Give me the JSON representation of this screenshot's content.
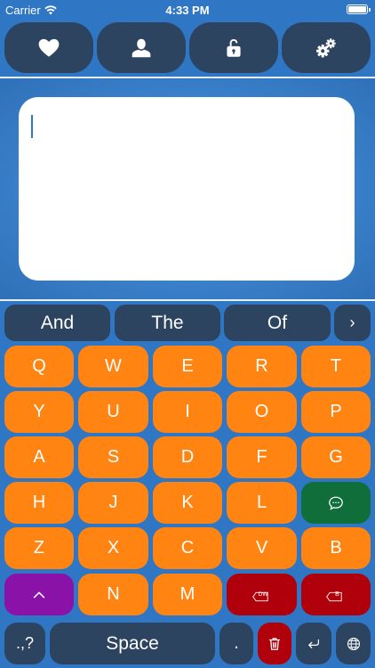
{
  "status": {
    "carrier": "Carrier",
    "time": "4:33 PM"
  },
  "toolbar": {
    "buttons": [
      {
        "name": "favorites",
        "icon": "heart-icon"
      },
      {
        "name": "profile",
        "icon": "user-icon"
      },
      {
        "name": "lock",
        "icon": "unlock-icon"
      },
      {
        "name": "settings",
        "icon": "gears-icon"
      }
    ]
  },
  "editor": {
    "text": ""
  },
  "suggestions": {
    "items": [
      "And",
      "The",
      "Of"
    ],
    "more": "›"
  },
  "keys": {
    "row1": [
      "Q",
      "W",
      "E",
      "R",
      "T"
    ],
    "row2": [
      "Y",
      "U",
      "I",
      "O",
      "P"
    ],
    "row3": [
      "A",
      "S",
      "D",
      "F",
      "G"
    ],
    "row4": [
      "H",
      "J",
      "K",
      "L"
    ],
    "row5": [
      "Z",
      "X",
      "C",
      "V",
      "B"
    ],
    "row6": [
      "N",
      "M"
    ],
    "delete_word_label": "DW",
    "delete_char_label": "B",
    "punctuation": ".,?",
    "space": "Space",
    "period": "."
  },
  "colors": {
    "background": "#2f76c4",
    "button_navy": "#2c4460",
    "letter_key": "#ff8411",
    "speak_key": "#0f6e3a",
    "shift_key": "#8a12a8",
    "delete_key": "#b0000b"
  }
}
